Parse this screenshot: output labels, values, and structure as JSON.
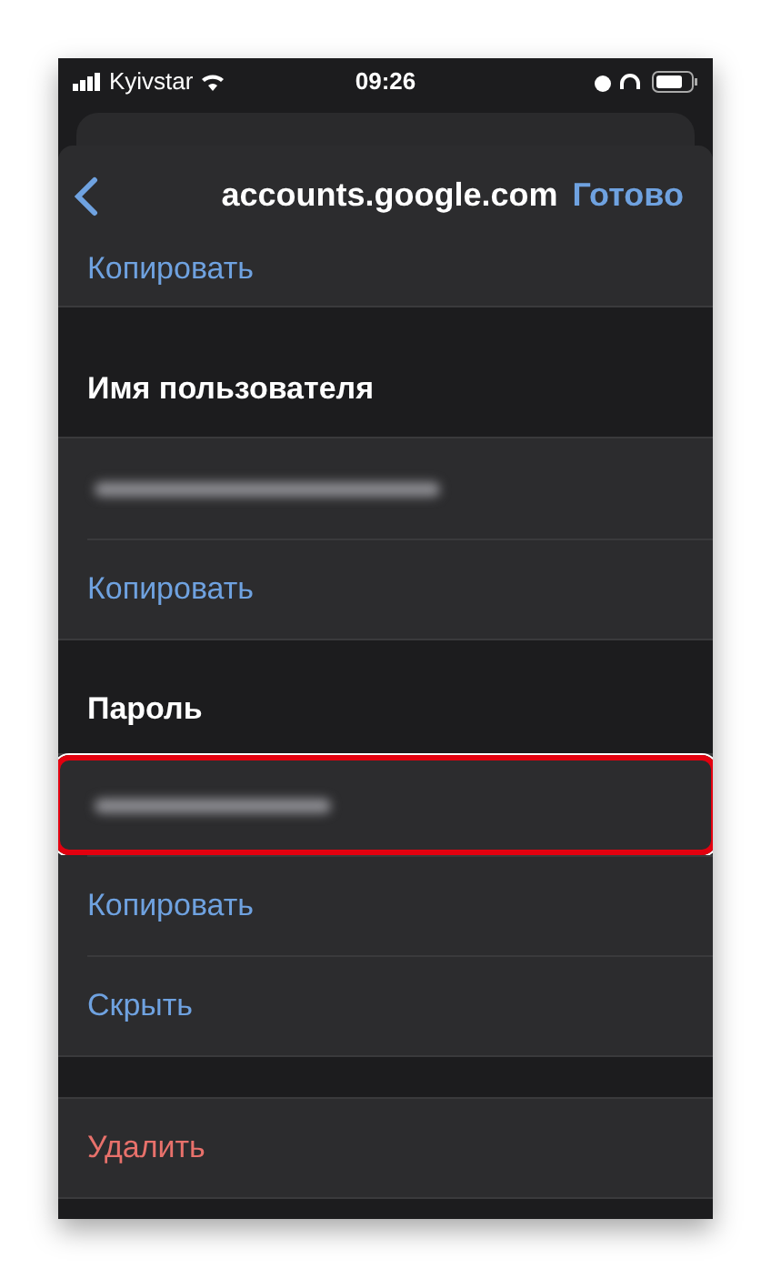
{
  "status_bar": {
    "carrier": "Kyivstar",
    "time": "09:26"
  },
  "nav": {
    "title": "accounts.google.com",
    "done": "Готово"
  },
  "rows": [
    {
      "kind": "action",
      "label": "Копировать",
      "destructive": false
    },
    {
      "kind": "header",
      "label": "Имя пользователя"
    },
    {
      "kind": "secret",
      "highlighted": false
    },
    {
      "kind": "action",
      "label": "Копировать",
      "destructive": false
    },
    {
      "kind": "header",
      "label": "Пароль"
    },
    {
      "kind": "secret",
      "highlighted": true
    },
    {
      "kind": "action",
      "label": "Копировать",
      "destructive": false
    },
    {
      "kind": "action",
      "label": "Скрыть",
      "destructive": false
    },
    {
      "kind": "spacer"
    },
    {
      "kind": "action",
      "label": "Удалить",
      "destructive": true
    }
  ]
}
